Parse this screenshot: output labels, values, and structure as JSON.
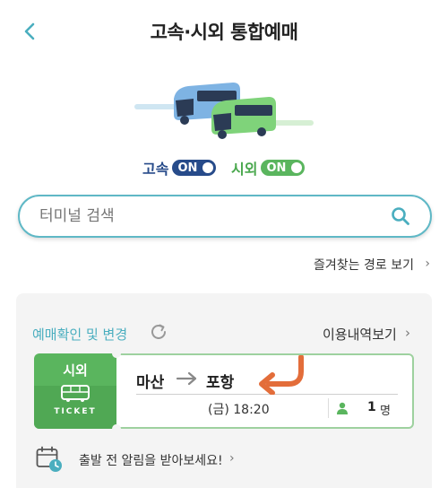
{
  "header": {
    "title": "고속·시외 통합예매",
    "back_icon": "chevron-left-icon"
  },
  "colors": {
    "teal": "#4aaebf",
    "express_blue": "#274b8a",
    "intercity_green": "#5ab55e",
    "arrow_orange": "#e36d3a"
  },
  "toggles": {
    "express": {
      "label": "고속",
      "state": "ON"
    },
    "intercity": {
      "label": "시외",
      "state": "ON"
    }
  },
  "search": {
    "placeholder": "터미널 검색",
    "icon": "search-icon"
  },
  "favorites": {
    "label": "즐겨찾는 경로 보기",
    "chevron": "›"
  },
  "reservation": {
    "confirm_label": "예매확인 및 변경",
    "history_label": "이용내역보기",
    "chevron": "›",
    "ticket": {
      "type": "시외",
      "stub_text": "TICKET",
      "from": "마산",
      "to": "포항",
      "depart": "(금) 18:20",
      "passengers": "1",
      "passenger_unit": "명"
    }
  },
  "alarm": {
    "label": "출발 전 알림을 받아보세요!",
    "chevron": "›"
  }
}
